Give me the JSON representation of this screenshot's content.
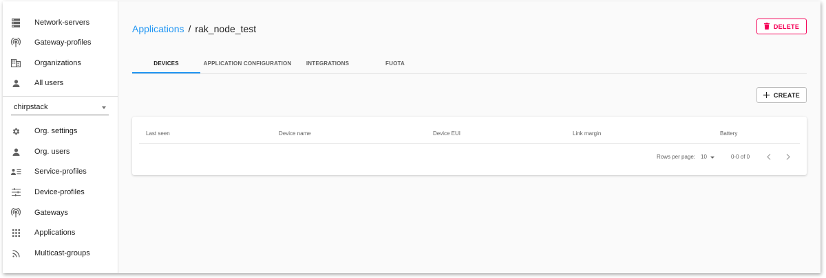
{
  "sidebar": {
    "admin_items": [
      {
        "label": "Network-servers",
        "icon": "server-icon"
      },
      {
        "label": "Gateway-profiles",
        "icon": "radio-tower-icon"
      },
      {
        "label": "Organizations",
        "icon": "domain-icon"
      },
      {
        "label": "All users",
        "icon": "user-icon"
      }
    ],
    "org_select": {
      "value": "chirpstack"
    },
    "org_items": [
      {
        "label": "Org. settings",
        "icon": "gear-icon"
      },
      {
        "label": "Org. users",
        "icon": "user-icon"
      },
      {
        "label": "Service-profiles",
        "icon": "account-details-icon"
      },
      {
        "label": "Device-profiles",
        "icon": "tune-icon"
      },
      {
        "label": "Gateways",
        "icon": "radio-tower-icon"
      },
      {
        "label": "Applications",
        "icon": "apps-grid-icon"
      },
      {
        "label": "Multicast-groups",
        "icon": "rss-icon"
      }
    ]
  },
  "header": {
    "breadcrumb_link": "Applications",
    "breadcrumb_separator": "/",
    "breadcrumb_current": "rak_node_test",
    "delete_label": "DELETE"
  },
  "tabs": [
    {
      "label": "DEVICES",
      "active": true
    },
    {
      "label": "APPLICATION CONFIGURATION",
      "active": false
    },
    {
      "label": "INTEGRATIONS",
      "active": false
    },
    {
      "label": "FUOTA",
      "active": false
    }
  ],
  "toolbar": {
    "create_label": "CREATE"
  },
  "table": {
    "columns": [
      "Last seen",
      "Device name",
      "Device EUI",
      "Link margin",
      "Battery"
    ]
  },
  "pagination": {
    "rows_per_page_label": "Rows per page:",
    "rows_per_page": "10",
    "range": "0-0 of 0"
  },
  "colors": {
    "accent": "#2196f3",
    "danger": "#f50057"
  }
}
